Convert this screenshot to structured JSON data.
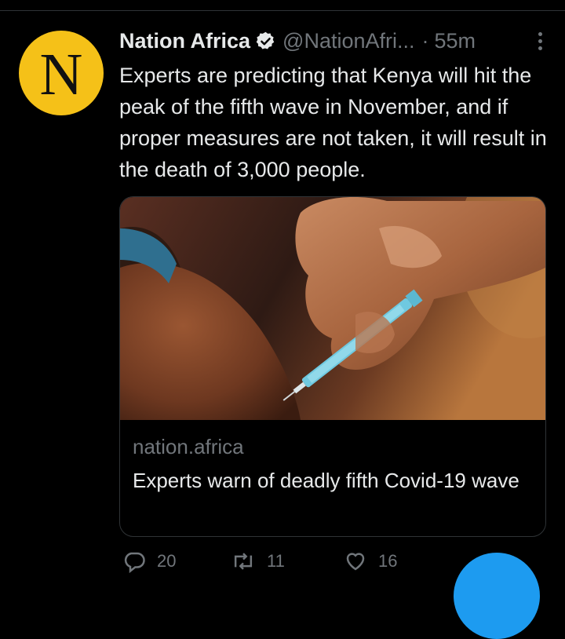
{
  "tweet": {
    "author_name": "Nation Africa",
    "handle": "@NationAfri...",
    "separator": "·",
    "time": "55m",
    "avatar_letter": "N",
    "avatar_color": "#f5c118",
    "text": "Experts are predicting that Kenya will hit the peak of the fifth wave in November, and if proper measures are not taken, it will result in the death of 3,000 people."
  },
  "card": {
    "domain": "nation.africa",
    "title": "Experts warn of deadly fifth Covid-19 wave",
    "image_subject": "syringe-injection-photo"
  },
  "actions": {
    "reply_count": "20",
    "retweet_count": "11",
    "like_count": "16"
  },
  "icons": {
    "verified": "verified-badge-icon",
    "more": "more-vertical-icon",
    "reply": "reply-icon",
    "retweet": "retweet-icon",
    "like": "heart-icon",
    "compose": "compose-icon"
  },
  "colors": {
    "background": "#000000",
    "text": "#e7e9ea",
    "secondary": "#71767b",
    "accent": "#1d9bf0",
    "border": "#2f3336"
  }
}
